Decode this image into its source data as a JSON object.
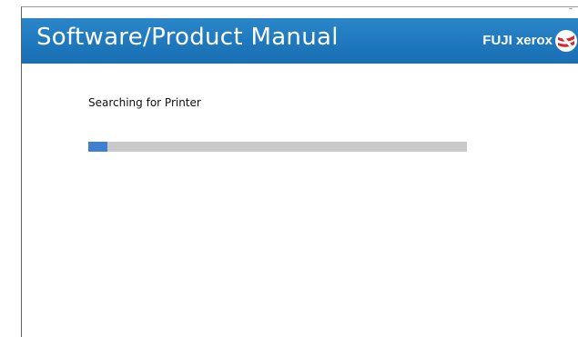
{
  "window": {
    "minimize_label": "–"
  },
  "header": {
    "title": "Software/Product Manual",
    "brand": "FUJI xerox",
    "brand_icon": "fuji-xerox-logo-icon",
    "color": "#1f78bd"
  },
  "main": {
    "status_text": "Searching for Printer",
    "progress": 0.05,
    "progress_color": "#3f7fcf",
    "track_color": "#c9c9c9"
  }
}
